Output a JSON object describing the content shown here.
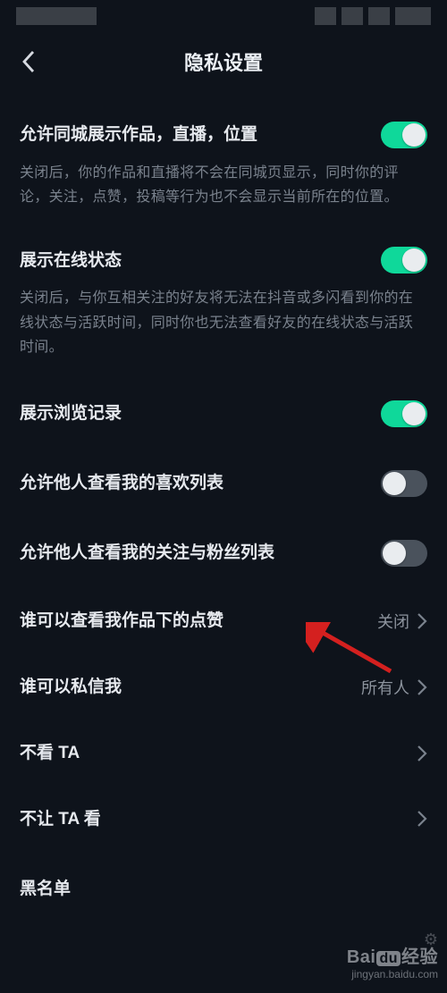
{
  "nav": {
    "title": "隐私设置"
  },
  "items": [
    {
      "key": "local-display",
      "label": "允许同城展示作品，直播，位置",
      "desc": "关闭后，你的作品和直播将不会在同城页显示，同时你的评论，关注，点赞，投稿等行为也不会显示当前所在的位置。",
      "toggle": true,
      "on": true
    },
    {
      "key": "online-status",
      "label": "展示在线状态",
      "desc": "关闭后，与你互相关注的好友将无法在抖音或多闪看到你的在线状态与活跃时间，同时你也无法查看好友的在线状态与活跃时间。",
      "toggle": true,
      "on": true
    },
    {
      "key": "browse-history",
      "label": "展示浏览记录",
      "toggle": true,
      "on": true
    },
    {
      "key": "view-like-list",
      "label": "允许他人查看我的喜欢列表",
      "toggle": true,
      "on": false
    },
    {
      "key": "view-follow-list",
      "label": "允许他人查看我的关注与粉丝列表",
      "toggle": true,
      "on": false
    },
    {
      "key": "who-view-likes",
      "label": "谁可以查看我作品下的点赞",
      "value": "关闭",
      "nav": true
    },
    {
      "key": "who-dm",
      "label": "谁可以私信我",
      "value": "所有人",
      "nav": true
    },
    {
      "key": "not-see-ta",
      "label": "不看 TA",
      "nav": true
    },
    {
      "key": "not-let-ta",
      "label": "不让 TA 看",
      "nav": true
    }
  ],
  "cutoff_label": "黑名单",
  "watermark": {
    "brand": "Bai",
    "du": "du",
    "suffix": "经验",
    "url": "jingyan.baidu.com"
  }
}
